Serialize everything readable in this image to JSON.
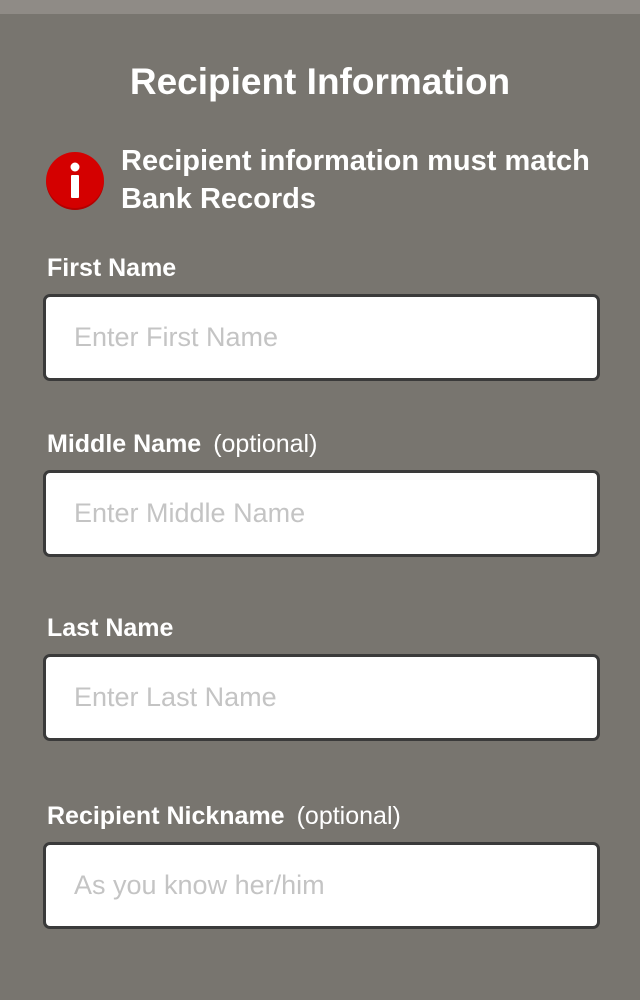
{
  "header": {
    "title": "Recipient Information"
  },
  "notice": {
    "icon": "info-icon",
    "icon_color": "#d40000",
    "text": "Recipient information must match Bank Records"
  },
  "fields": [
    {
      "label": "First Name",
      "optional": "",
      "placeholder": "Enter First Name",
      "value": ""
    },
    {
      "label": "Middle Name",
      "optional": "(optional)",
      "placeholder": "Enter Middle Name",
      "value": ""
    },
    {
      "label": "Last Name",
      "optional": "",
      "placeholder": "Enter Last Name",
      "value": ""
    },
    {
      "label": "Recipient Nickname",
      "optional": "(optional)",
      "placeholder": "As you know her/him",
      "value": ""
    }
  ],
  "colors": {
    "background": "#78756f",
    "text": "#ffffff",
    "placeholder": "#c4c4c4"
  }
}
